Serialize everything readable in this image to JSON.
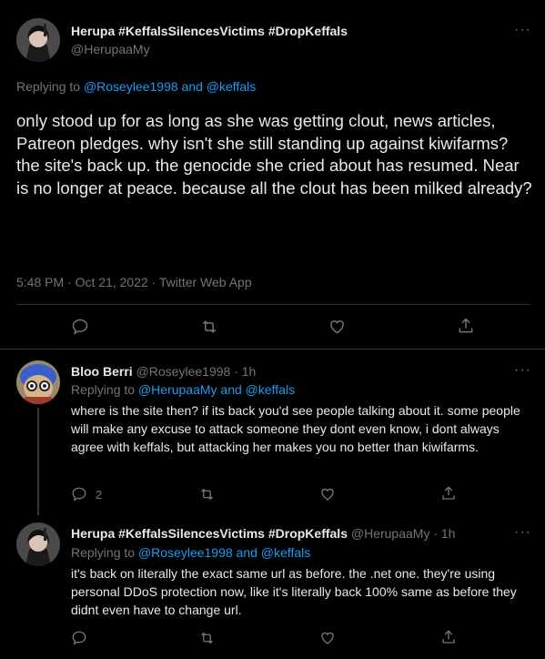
{
  "main_tweet": {
    "display_name": "Herupa #KeffalsSilencesVictims #DropKeffals",
    "handle": "@HerupaaMy",
    "replying_prefix": "Replying to",
    "replying_users": "@Roseylee1998 and @keffals",
    "text": "only stood up for as long as she was getting clout, news articles, Patreon pledges. why isn't she still standing up against kiwifarms? the site's back up. the genocide she cried about has resumed. Near is no longer at peace. because all the clout has been milked already?",
    "meta": "5:48 PM · Oct 21, 2022 · Twitter Web App"
  },
  "reply1": {
    "display_name": "Bloo Berri",
    "handle_time": "@Roseylee1998 · 1h",
    "replying_prefix": "Replying to",
    "replying_users": "@HerupaaMy and @keffals",
    "text": "where is the site then? if its back you'd see people talking about it. some people will make any excuse to attack someone they dont even know, i dont always agree with keffals, but attacking her makes you no better than kiwifarms.",
    "reply_count": "2"
  },
  "reply2": {
    "display_name": "Herupa #KeffalsSilencesVictims #DropKeffals",
    "handle_time": "@HerupaaMy · 1h",
    "replying_prefix": "Replying to",
    "replying_users": "@Roseylee1998 and @keffals",
    "text": "it's back on literally the exact same url as before. the .net one. they're using personal DDoS protection now, like it's literally back 100% same as before they didnt even have to change url."
  },
  "more_label": "···",
  "colors": {
    "background": "#000000",
    "text": "#e7e9ea",
    "muted": "#71767b",
    "link": "#1d9bf0",
    "divider": "#2f3336"
  }
}
